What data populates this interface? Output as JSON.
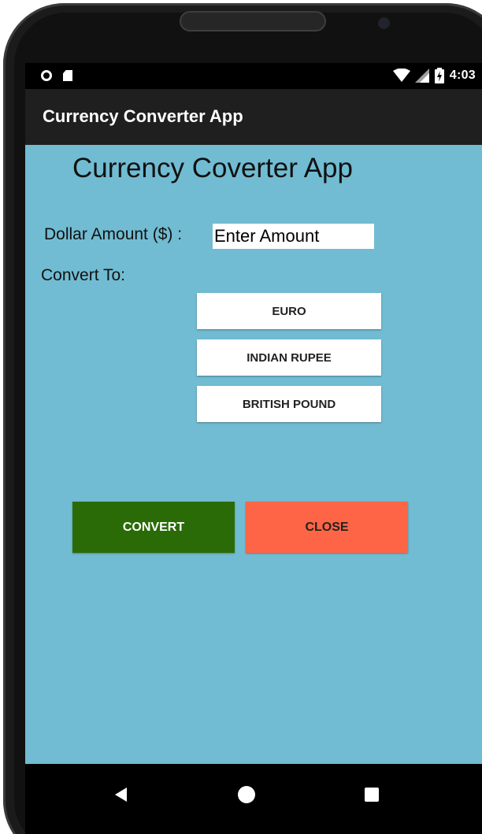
{
  "status_bar": {
    "time": "4:03",
    "icons": [
      "record-icon",
      "sd-card-icon",
      "wifi-icon",
      "signal-icon",
      "battery-charging-icon"
    ]
  },
  "app_bar": {
    "title": "Currency Converter App"
  },
  "main": {
    "heading": "Currency Coverter App",
    "amount_label": "Dollar Amount ($) :",
    "amount_input": {
      "placeholder": "Enter Amount",
      "value": ""
    },
    "convert_to_label": "Convert To:",
    "options": [
      {
        "label": "EURO"
      },
      {
        "label": "INDIAN RUPEE"
      },
      {
        "label": "BRITISH POUND"
      }
    ],
    "convert_button": "CONVERT",
    "close_button": "CLOSE"
  },
  "colors": {
    "screen_background": "#71bcd2",
    "app_bar_background": "#1f1f1f",
    "convert_button": "#2a6b07",
    "close_button": "#fd6546",
    "option_button": "#ffffff"
  },
  "nav_bar": {
    "icons": [
      "back-icon",
      "home-icon",
      "recents-icon"
    ]
  }
}
